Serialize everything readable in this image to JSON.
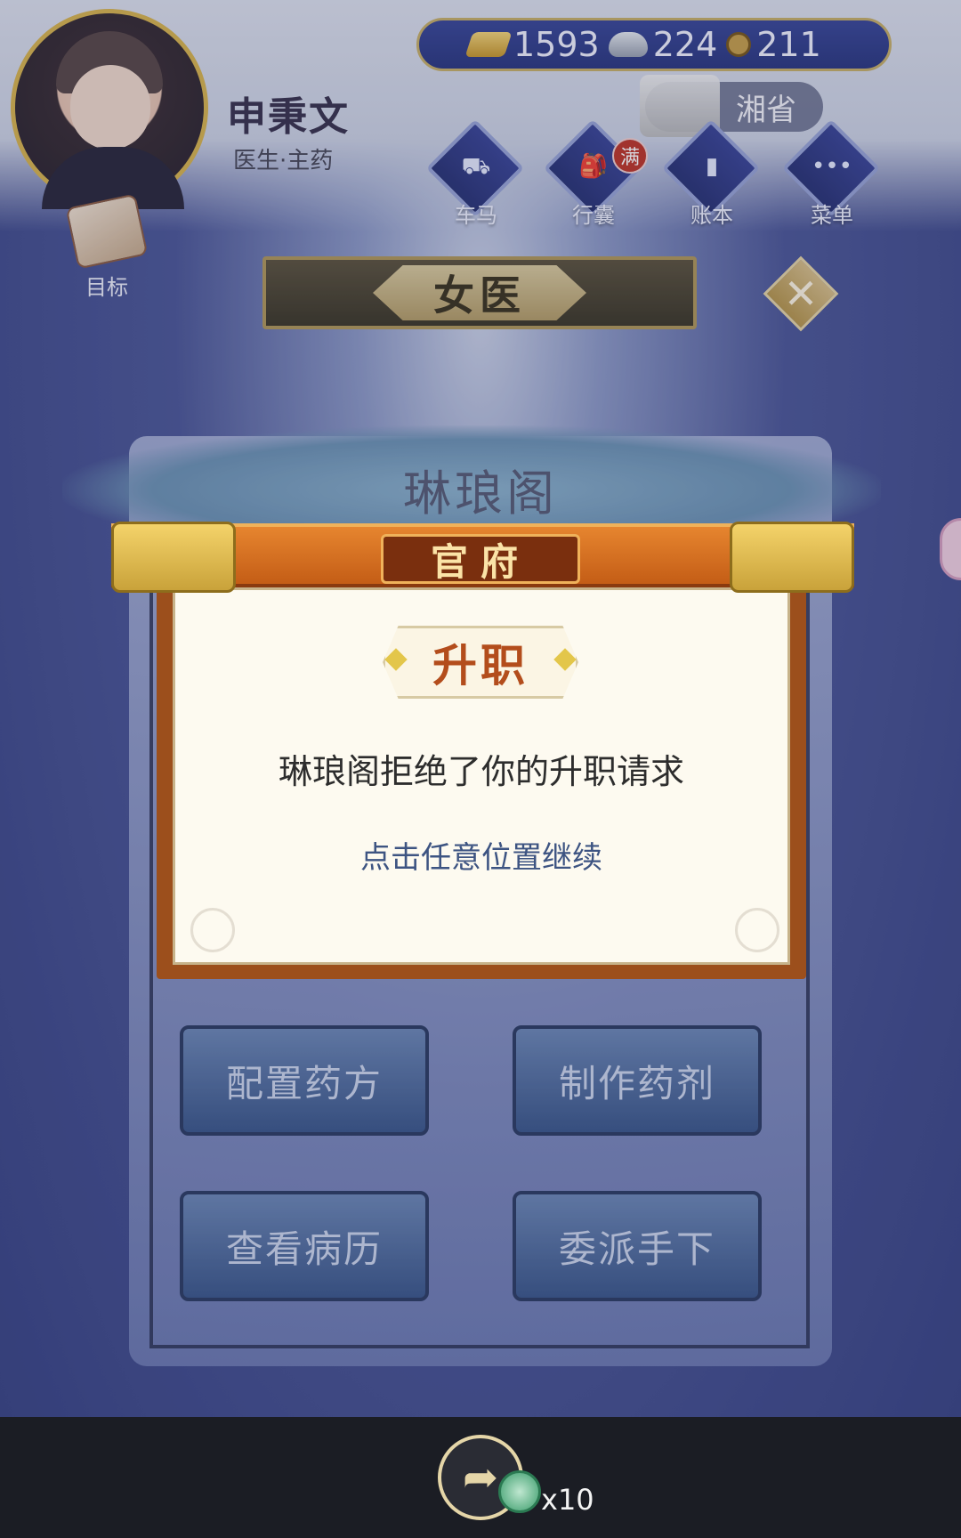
{
  "player": {
    "name": "申秉文",
    "title": "医生·主药"
  },
  "target": {
    "label": "目标"
  },
  "currency": {
    "gold": "1593",
    "silver": "224",
    "coin": "211"
  },
  "location": {
    "label": "湘省"
  },
  "menu": {
    "items": [
      {
        "label": "车马"
      },
      {
        "label": "行囊",
        "badge": "满"
      },
      {
        "label": "账本"
      },
      {
        "label": "菜单"
      }
    ]
  },
  "screen": {
    "title": "女医"
  },
  "panel": {
    "name": "琳琅阁",
    "buttons": [
      {
        "label": "配置药方"
      },
      {
        "label": "制作药剂"
      },
      {
        "label": "查看病历"
      },
      {
        "label": "委派手下"
      }
    ]
  },
  "dialog": {
    "ribbon_title": "官府",
    "heading": "升职",
    "message": "琳琅阁拒绝了你的升职请求",
    "hint": "点击任意位置继续"
  },
  "bottom": {
    "reward_count": "x10"
  },
  "icons": {
    "close": "close-icon",
    "share": "share-icon",
    "reward": "jade-coin-icon"
  }
}
